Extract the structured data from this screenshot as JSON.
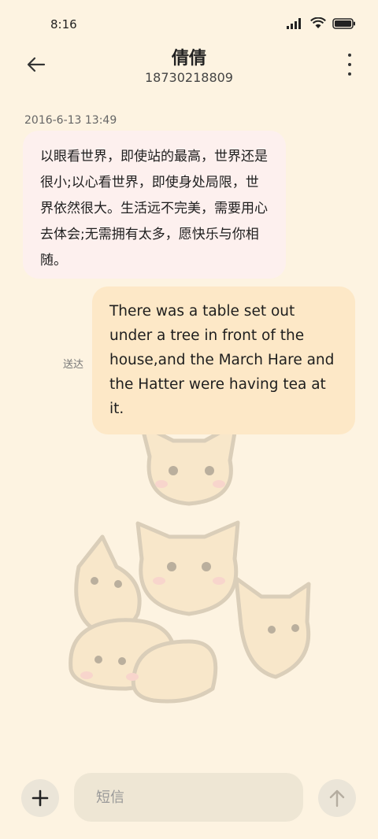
{
  "status_bar": {
    "time": "8:16",
    "icons": [
      "signal-icon",
      "wifi-icon",
      "battery-icon"
    ]
  },
  "header": {
    "back_icon": "arrow-left-icon",
    "contact_name": "倩倩",
    "contact_number": "18730218809",
    "more_icon": "more-vertical-icon"
  },
  "conversation": {
    "timestamp": "2016-6-13 13:49",
    "incoming_message": "以眼看世界，即使站的最高，世界还是很小;以心看世界，即使身处局限，世界依然很大。生活远不完美，需要用心去体会;无需拥有太多，愿快乐与你相随。",
    "outgoing_message": "There was a table set out under a tree in front of the house,and the March Hare and the Hatter were having tea at it.",
    "delivery_status": "送达"
  },
  "composer": {
    "add_icon": "plus-icon",
    "placeholder": "短信",
    "send_icon": "arrow-up-icon"
  },
  "colors": {
    "background": "#fdf3e1",
    "incoming_bubble": "#fdf0ee",
    "outgoing_bubble": "#fde8c7",
    "button_bg": "#ebe5d8"
  }
}
